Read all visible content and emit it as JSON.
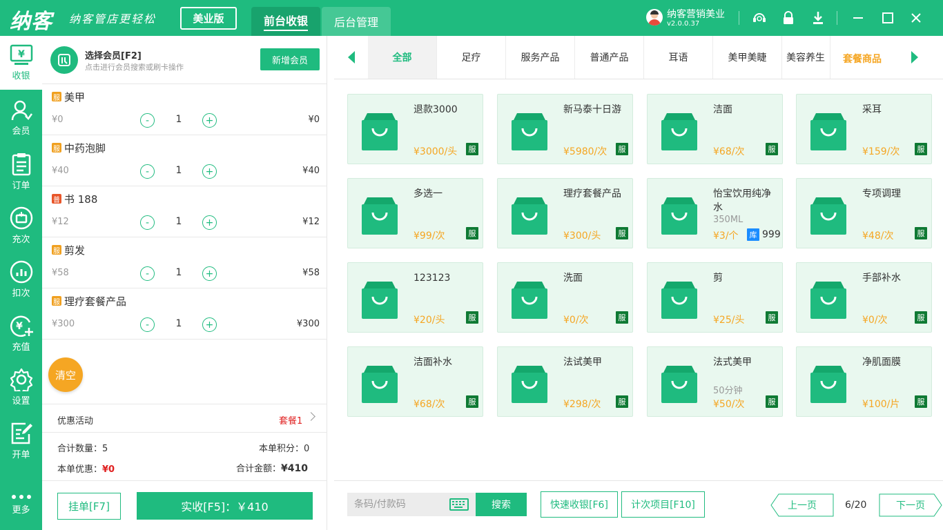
{
  "header": {
    "logo": "纳客",
    "slogan": "纳客管店更轻松",
    "edition": "美业版",
    "tabs": [
      {
        "label": "前台收银",
        "active": true
      },
      {
        "label": "后台管理",
        "active": false
      }
    ],
    "user_name": "纳客营销美业",
    "version": "v2.0.0.37",
    "icons": [
      "support-icon",
      "lock-icon",
      "download-icon",
      "minimize-icon",
      "maximize-icon",
      "close-icon"
    ]
  },
  "sidebar": {
    "items": [
      {
        "label": "收银",
        "icon": "cashier-icon",
        "active": true
      },
      {
        "label": "会员",
        "icon": "member-icon"
      },
      {
        "label": "订单",
        "icon": "order-icon"
      },
      {
        "label": "充次",
        "icon": "recharge-times-icon"
      },
      {
        "label": "扣次",
        "icon": "deduct-times-icon"
      },
      {
        "label": "充值",
        "icon": "recharge-icon"
      },
      {
        "label": "设置",
        "icon": "settings-icon"
      },
      {
        "label": "开单",
        "icon": "billing-icon"
      },
      {
        "label": "更多",
        "icon": "more-icon"
      }
    ]
  },
  "order": {
    "member_title": "选择会员[F2]",
    "member_hint": "点击进行会员搜索或刷卡操作",
    "new_member": "新增会员",
    "items": [
      {
        "tag": "服",
        "tag_color": "#f0a020",
        "name": "美甲",
        "unit": "¥0",
        "qty": "1",
        "total": "¥0"
      },
      {
        "tag": "服",
        "tag_color": "#f0a020",
        "name": "中药泡脚",
        "unit": "¥40",
        "qty": "1",
        "total": "¥40"
      },
      {
        "tag": "普",
        "tag_color": "#e8562a",
        "name": "书 188",
        "unit": "¥12",
        "qty": "1",
        "total": "¥12"
      },
      {
        "tag": "服",
        "tag_color": "#f0a020",
        "name": "剪发",
        "unit": "¥58",
        "qty": "1",
        "total": "¥58"
      },
      {
        "tag": "服",
        "tag_color": "#f0a020",
        "name": "理疗套餐产品",
        "unit": "¥300",
        "qty": "1",
        "total": "¥300"
      }
    ],
    "clear": "清空",
    "promo_label": "优惠活动",
    "promo_value": "套餐1",
    "count_label": "合计数量：",
    "count": "5",
    "points_label": "本单积分：",
    "points": "0",
    "discount_label": "本单优惠：",
    "discount": "¥0",
    "total_label": "合计金额：",
    "total": "¥410",
    "hang_label": "挂单[F7]",
    "pay_label": "实收[F5]：￥410"
  },
  "categories": {
    "items": [
      "全部",
      "足疗",
      "服务产品",
      "普通产品",
      "耳语",
      "美甲美睫",
      "美容养生"
    ],
    "active_index": 0,
    "extra": "套餐商品"
  },
  "products": [
    {
      "name": "退款3000",
      "sub": "",
      "price": "¥3000/头",
      "tag": "服"
    },
    {
      "name": "新马泰十日游",
      "sub": "",
      "price": "¥5980/次",
      "tag": "服"
    },
    {
      "name": "洁面",
      "sub": "",
      "price": "¥68/次",
      "tag": "服"
    },
    {
      "name": "采耳",
      "sub": "",
      "price": "¥159/次",
      "tag": "服"
    },
    {
      "name": "多选一",
      "sub": "",
      "price": "¥99/次",
      "tag": "服"
    },
    {
      "name": "理疗套餐产品",
      "sub": "",
      "price": "¥300/头",
      "tag": "服"
    },
    {
      "name": "怡宝饮用纯净水",
      "sub": "350ML",
      "price": "¥3/个",
      "tag": "",
      "stock_tag": "库",
      "stock": "999"
    },
    {
      "name": "专项调理",
      "sub": "",
      "price": "¥48/次",
      "tag": "服"
    },
    {
      "name": "123123",
      "sub": "",
      "price": "¥20/头",
      "tag": "服"
    },
    {
      "name": "洗面",
      "sub": "",
      "price": "¥0/次",
      "tag": "服"
    },
    {
      "name": "剪",
      "sub": "",
      "price": "¥25/头",
      "tag": "服"
    },
    {
      "name": "手部补水",
      "sub": "",
      "price": "¥0/次",
      "tag": "服"
    },
    {
      "name": "洁面补水",
      "sub": "",
      "price": "¥68/次",
      "tag": "服"
    },
    {
      "name": "法试美甲",
      "sub": "",
      "price": "¥298/次",
      "tag": "服"
    },
    {
      "name": "法式美甲",
      "sub": "50分钟",
      "price": "¥50/次",
      "tag": "服"
    },
    {
      "name": "净肌面膜",
      "sub": "",
      "price": "¥100/片",
      "tag": "服"
    }
  ],
  "bottom": {
    "barcode_placeholder": "条码/付款码",
    "search": "搜索",
    "quick_pay": "快速收银[F6]",
    "count_item": "计次项目[F10]",
    "prev": "上一页",
    "page": "6/20",
    "next": "下一页"
  },
  "colors": {
    "brand": "#1fbb7f",
    "price": "#f5a623",
    "discount": "#e02020",
    "service_tag": "#0f7a34",
    "stock_tag": "#1a8cff"
  }
}
